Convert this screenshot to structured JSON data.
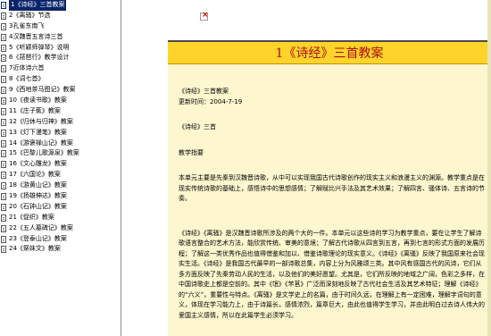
{
  "sidebar": {
    "items": [
      {
        "label": "1《诗经》三首教案",
        "selected": true
      },
      {
        "label": "2《离骚》节选"
      },
      {
        "label": "3孔雀东南飞"
      },
      {
        "label": "4汉魏晋五言诗三首"
      },
      {
        "label": "5《听颖师弹琴》说明"
      },
      {
        "label": "6《琵琶行》教学设计"
      },
      {
        "label": "7近体诗六首"
      },
      {
        "label": "8《词七首》"
      },
      {
        "label": "9《西地茶马图记》教案"
      },
      {
        "label": "10《夜读书歌》教案"
      },
      {
        "label": "11《庄子蕉》教案"
      },
      {
        "label": "12《归休与归神》教案"
      },
      {
        "label": "13《灯下漫笔》教案"
      },
      {
        "label": "14《游褒禅山记》教案"
      },
      {
        "label": "15《巴黎儿歌源泉》教案"
      },
      {
        "label": "16《文心雕龙》教案"
      },
      {
        "label": "17《六国论》教案"
      },
      {
        "label": "18《游黄山记》教案"
      },
      {
        "label": "19《扬雄伸达》教案"
      },
      {
        "label": "20《石钟山记》教案"
      },
      {
        "label": "21《促织》教案"
      },
      {
        "label": "22《五人墓碑记》教案"
      },
      {
        "label": "23《登泰山记》教案"
      },
      {
        "label": "24《祭妹文》教案"
      }
    ]
  },
  "document": {
    "title": "1《诗经》三首教案",
    "heading": "《诗经》三首教案",
    "updated": "更新时间：2004-7-19",
    "subtitle": "《诗经》三首",
    "section": "教学指要",
    "para1": "本单元主要是先秦到汉魏晋诗歌，从中可以实现我国古代诗歌创作的现实主义和浪漫主义的渊源。教学重点是在现实传统诗歌的基础上，感悟诗中的思想感情；了解赋比兴手法及其艺术效果；了解四言、骚体诗、五言诗的节奏。",
    "para2": "《诗经》《离骚》是汉魏晋诗歌所涉及的两个大的一件。本单元以这些诗的学习为教学重点，要在让学生了解诗歌语言整合的艺术方法，能欣赏传统、审美的意境；了解古代诗歌从四言到五言，再到七言的形式方面的发展历程；了解这一类优秀作品也值得借鉴和加以、借鉴诗歌理论的现实意义。《诗经》《离骚》反映了我国原来社会现实生活。《诗经》是我国古代最早的一部诗歌总集，内容上分为风雅颂三类。其中风有感国古代的风诗，它们从多方面反映了先秦劳动人民的生活，以及他们的美好愿望。尤其是，它们所反映的地域之广阔，色彩之多样，在中国诗歌史上都是空前的。其中《氓》《芣苢》广泛而深刻地反映了古代社会生活及其艺术特征；理解《诗经》的“六义”，重要性与特点。《离骚》是文学史上的名篇，由于时间久远，在理解上有一定困难，理解字词句的意义，体现在学习能力上，由于诗篇长，感情浓烈，篇章巨大，由此也值得学生学习，并由此明白过去诗人伟大的爱国主义感情，所以在此篇学生必须学习。"
  }
}
